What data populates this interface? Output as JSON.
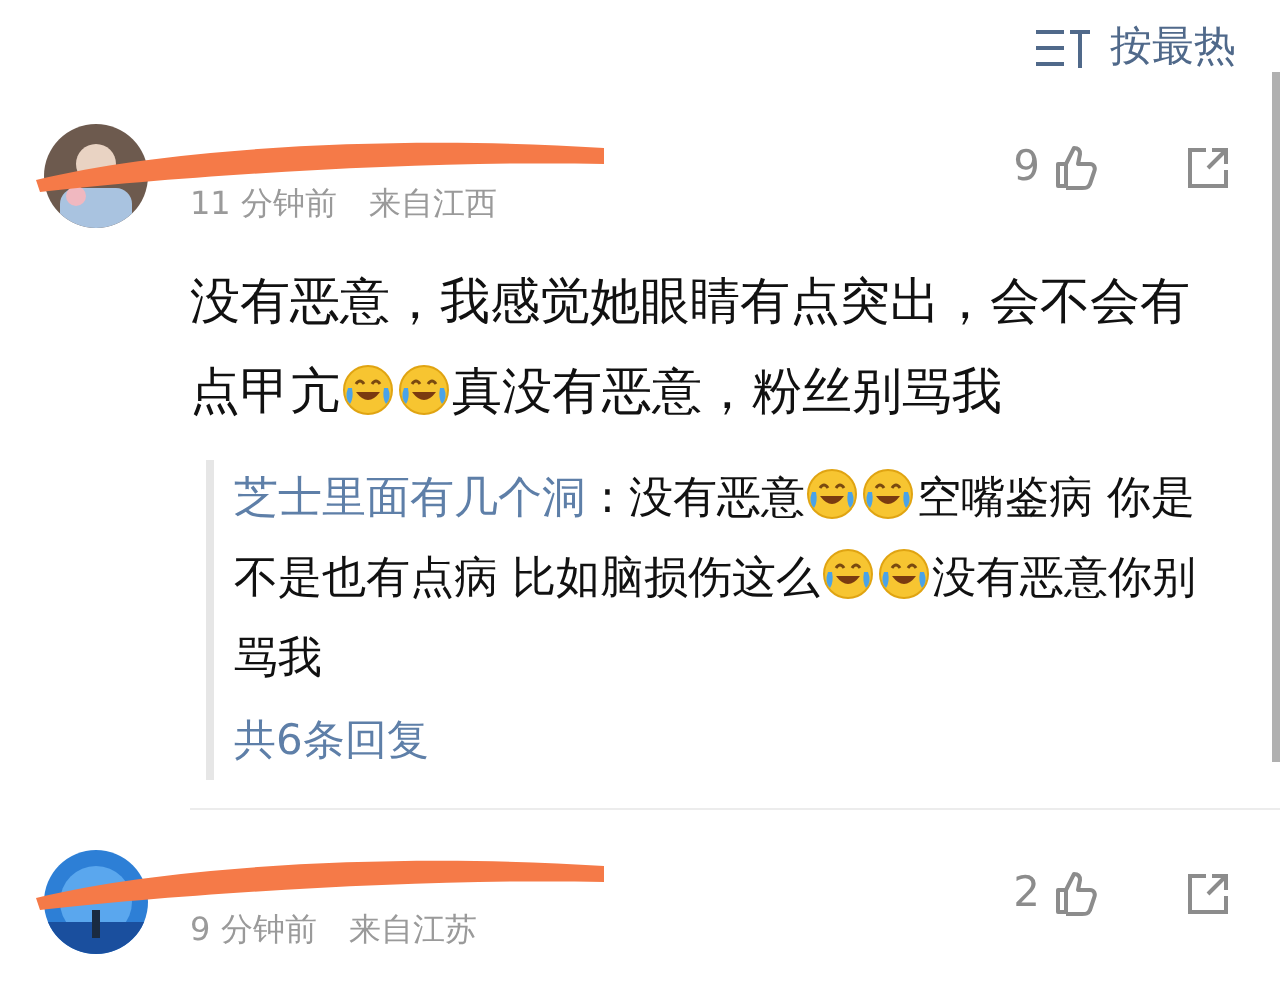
{
  "sort": {
    "label": "按最热"
  },
  "comments": [
    {
      "time": "11 分钟前",
      "location": "来自江西",
      "likes": "9",
      "body": [
        {
          "kind": "text",
          "text": "没有恶意，我感觉她眼睛有点突出，会不会有点甲亢"
        },
        {
          "kind": "emoji"
        },
        {
          "kind": "emoji"
        },
        {
          "kind": "text",
          "text": "真没有恶意，粉丝别骂我"
        }
      ],
      "reply": {
        "author": "芝士里面有几个洞",
        "separator": ":",
        "body": [
          {
            "kind": "text",
            "text": "没有恶意"
          },
          {
            "kind": "emoji"
          },
          {
            "kind": "emoji"
          },
          {
            "kind": "text",
            "text": "空嘴鉴病 你是不是也有点病 比如脑损伤这么"
          },
          {
            "kind": "emoji"
          },
          {
            "kind": "emoji"
          },
          {
            "kind": "text",
            "text": "没有恶意你别骂我"
          }
        ],
        "more": "共6条回复"
      }
    },
    {
      "time": "9 分钟前",
      "location": "来自江苏",
      "likes": "2"
    }
  ]
}
